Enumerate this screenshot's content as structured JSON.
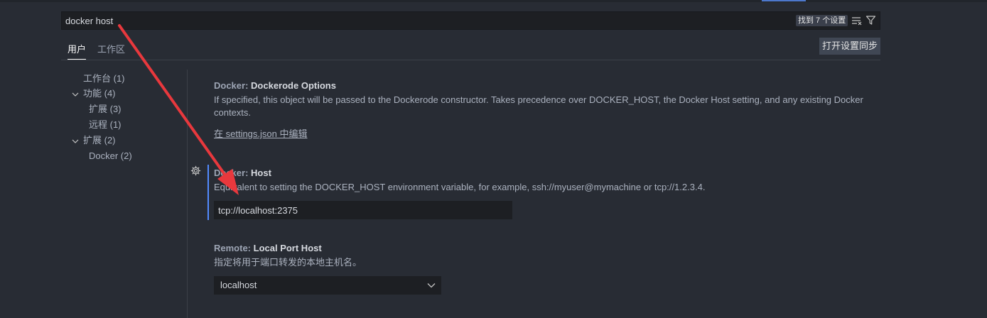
{
  "search": {
    "value": "docker host",
    "result_count": "找到 7 个设置"
  },
  "tabs": [
    {
      "label": "用户",
      "active": true
    },
    {
      "label": "工作区",
      "active": false
    }
  ],
  "sync_button": "打开设置同步",
  "toc": [
    {
      "label": "工作台 (1)",
      "expandable": false
    },
    {
      "label": "功能 (4)",
      "expandable": true
    },
    {
      "label": "扩展 (3)",
      "expandable": false
    },
    {
      "label": "远程 (1)",
      "expandable": false
    },
    {
      "label": "扩展 (2)",
      "expandable": true
    },
    {
      "label": "Docker (2)",
      "expandable": false
    }
  ],
  "settings": [
    {
      "category": "Docker: ",
      "name": "Dockerode Options",
      "description": "If specified, this object will be passed to the Dockerode constructor. Takes precedence over DOCKER_HOST, the Docker Host setting, and any existing Docker contexts.",
      "link": "在 settings.json 中编辑"
    },
    {
      "category": "Docker: ",
      "name": "Host",
      "description": "Equivalent to setting the DOCKER_HOST environment variable, for example, ssh://myuser@mymachine or tcp://1.2.3.4.",
      "value": "tcp://localhost:2375"
    },
    {
      "category": "Remote: ",
      "name": "Local Port Host",
      "description": "指定将用于端口转发的本地主机名。",
      "value": "localhost"
    }
  ],
  "colors": {
    "background": "#282c34",
    "accent": "#528bff",
    "annotation_arrow": "#e8383d"
  }
}
